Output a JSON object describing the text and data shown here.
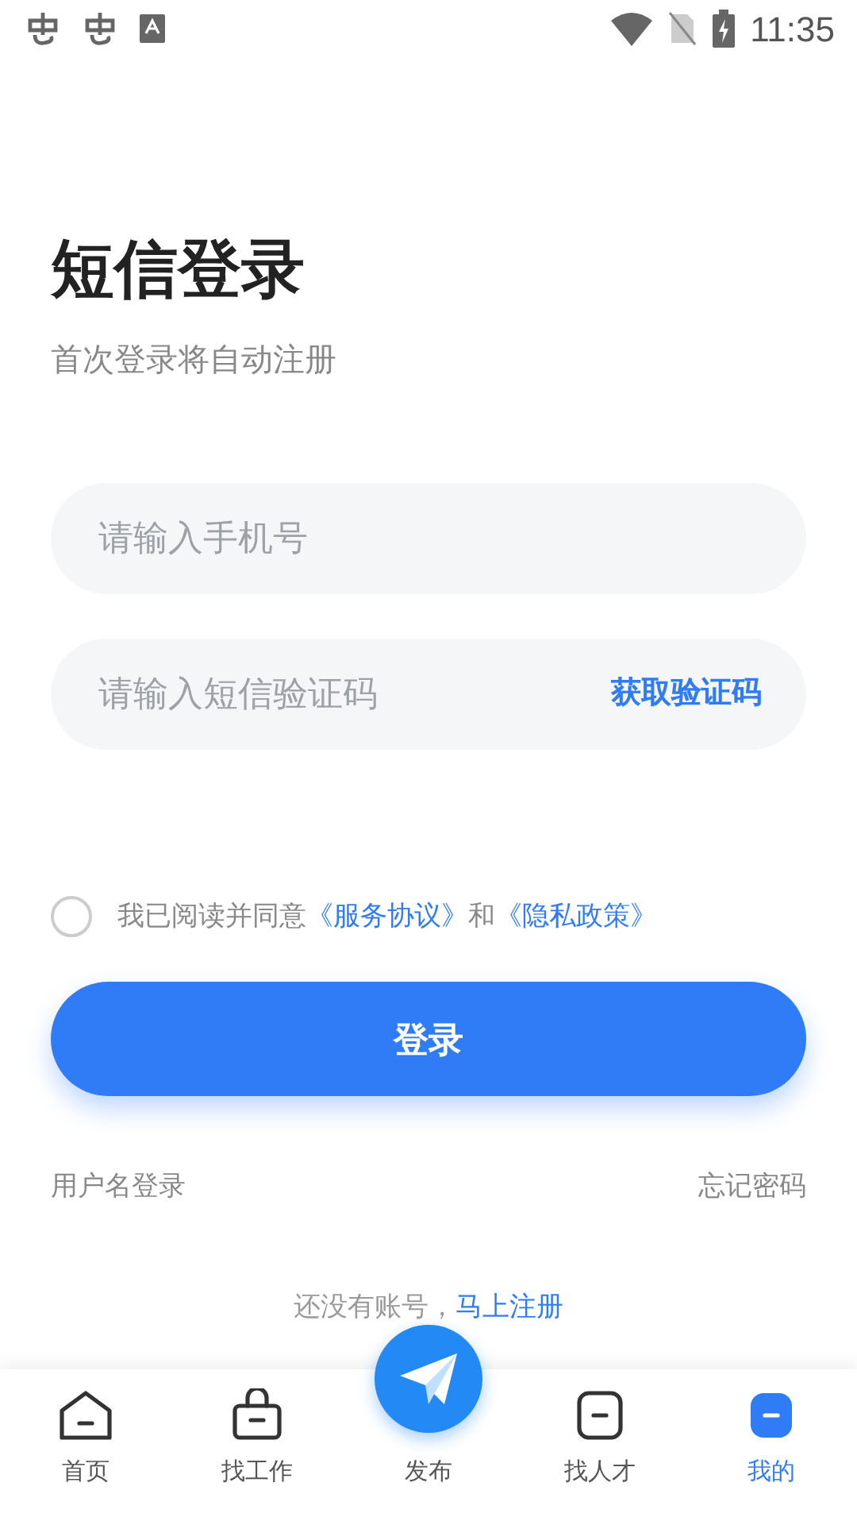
{
  "status_bar": {
    "time": "11:35"
  },
  "title": "短信登录",
  "subtitle": "首次登录将自动注册",
  "phone_field": {
    "placeholder": "请输入手机号"
  },
  "code_field": {
    "placeholder": "请输入短信验证码",
    "action": "获取验证码"
  },
  "agreement": {
    "checked": false,
    "text": "我已阅读并同意",
    "link_1": "《服务协议》",
    "joiner": "和",
    "link_2": "《隐私政策》"
  },
  "login_button": "登录",
  "username_login": "用户名登录",
  "forgot_password": "忘记密码",
  "register": {
    "text": "还没有账号，",
    "link": "马上注册"
  },
  "nav": [
    {
      "label": "首页",
      "kind": "tab",
      "selected": false
    },
    {
      "label": "找工作",
      "kind": "tab",
      "selected": false
    },
    {
      "label": "发布",
      "kind": "publish",
      "selected": false
    },
    {
      "label": "找人才",
      "kind": "tab",
      "selected": false
    },
    {
      "label": "我的",
      "kind": "tab",
      "selected": true
    }
  ]
}
